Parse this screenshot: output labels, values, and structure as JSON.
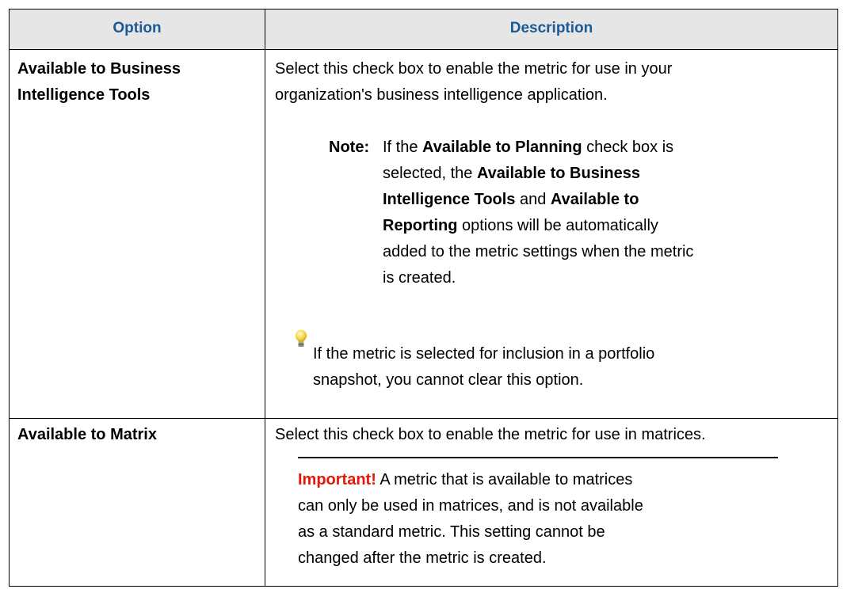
{
  "table": {
    "headers": {
      "option": "Option",
      "description": "Description"
    },
    "rows": [
      {
        "option_line1": "Available to Business",
        "option_line2": "Intelligence Tools",
        "desc_line1": "Select this check box to enable the metric for use in your",
        "desc_line2": "organization's business intelligence application.",
        "note": {
          "label": "Note:",
          "l1_a": "If the ",
          "l1_b": "Available to Planning",
          "l1_c": " check box is",
          "l2_a": "selected, the ",
          "l2_b": "Available to Business",
          "l3_a": "Intelligence Tools",
          "l3_b": " and ",
          "l3_c": "Available to",
          "l4_a": "Reporting",
          "l4_b": " options will be automatically",
          "l5": "added to the metric settings when the metric",
          "l6": "is created."
        },
        "tip": {
          "icon": "lightbulb-icon",
          "line1": "If the metric is selected for inclusion in a portfolio",
          "line2": "snapshot, you cannot clear this option."
        }
      },
      {
        "option": "Available to Matrix",
        "desc": "Select this check box to enable the metric for use in matrices.",
        "important": {
          "label": "Important!",
          "line1_rest": " A metric that is available to matrices",
          "line2": "can only be used in matrices, and is not available",
          "line3": "as a standard metric. This setting cannot be",
          "line4": "changed after the metric is created."
        }
      }
    ]
  },
  "colors": {
    "header_text": "#1b5a96",
    "header_bg": "#e6e6e6",
    "important": "#e3170a"
  }
}
